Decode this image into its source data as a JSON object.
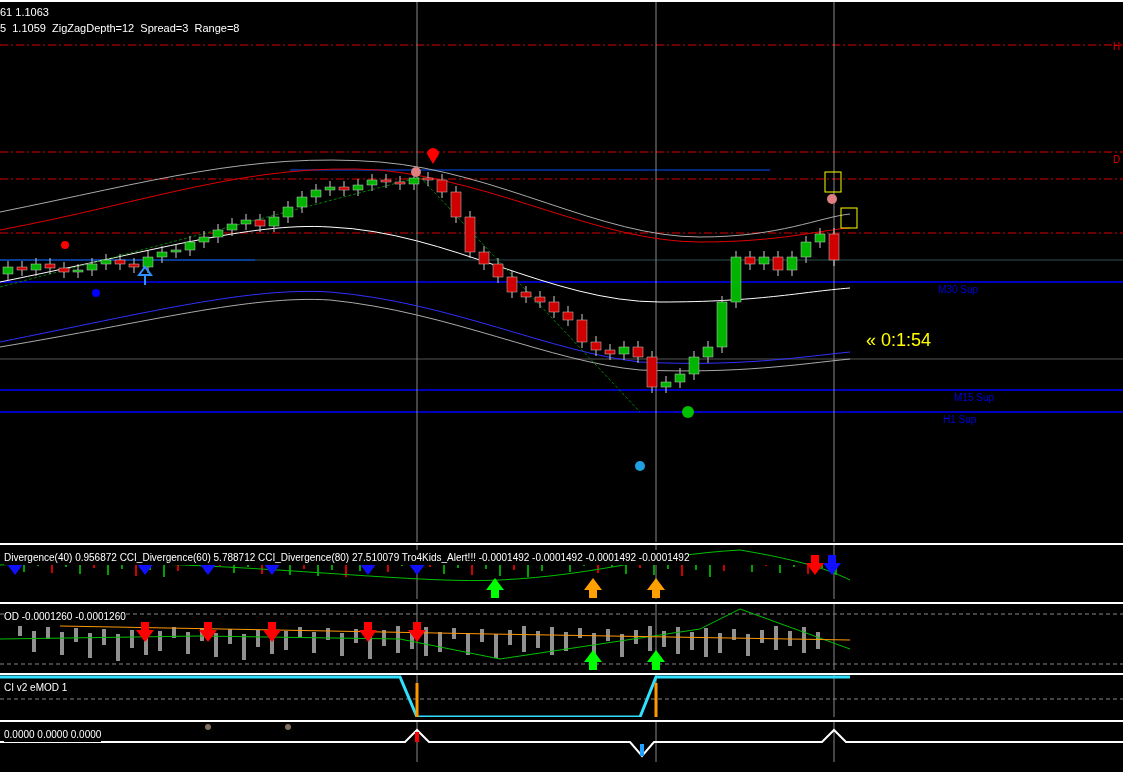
{
  "main_chart": {
    "header_lines": [
      "61 1.1063",
      "5  1.1059  ZigZagDepth=12  Spread=3  Range=8"
    ],
    "level_labels": [
      {
        "text": "H",
        "kind": "resistance"
      },
      {
        "text": "D",
        "kind": "resistance"
      },
      {
        "text": "M30 Sup",
        "kind": "support"
      },
      {
        "text": "M15 Sup",
        "kind": "support"
      },
      {
        "text": "H1 Sup",
        "kind": "support"
      }
    ],
    "timer": "« 0:1:54"
  },
  "subwindows": [
    {
      "header": "Divergence(40) 0.956872  CCI_Divergence(60) 5.788712  CCI_Divergence(80) 27.510079  Tro4Kids_Alert!!! -0.0001492 -0.0001492 -0.0001492 -0.0001492",
      "kind": "arrows"
    },
    {
      "header": "OD -0.0001260 -0.0001260",
      "kind": "histogram"
    },
    {
      "header": "CI v2 eMOD 1",
      "kind": "steps"
    },
    {
      "header": "0.0000 0.0000 0.0000",
      "kind": "markers"
    }
  ]
}
